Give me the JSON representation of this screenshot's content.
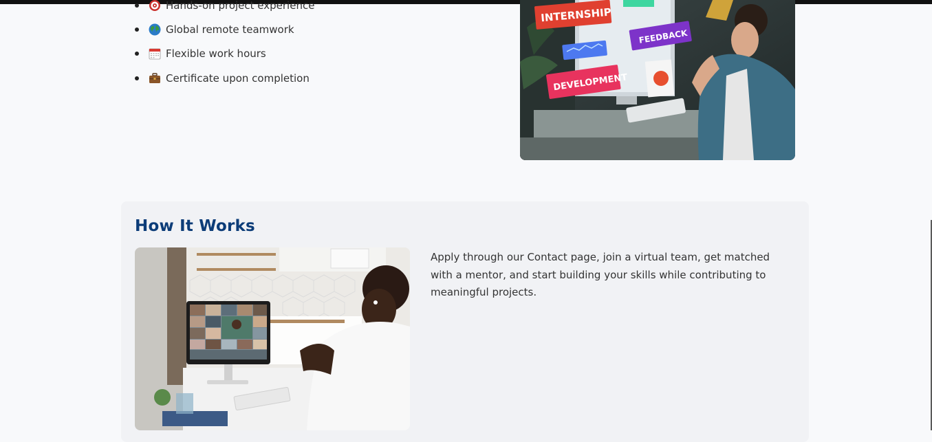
{
  "benefits": [
    {
      "icon": "target-icon",
      "label": "Hands-on project experience"
    },
    {
      "icon": "globe-icon",
      "label": "Global remote teamwork"
    },
    {
      "icon": "calendar-icon",
      "label": "Flexible work hours"
    },
    {
      "icon": "briefcase-icon",
      "label": "Certificate upon completion"
    }
  ],
  "hero_image": {
    "tags": [
      "INTERNSHIP",
      "FEEDBACK",
      "DEVELOPMENT"
    ]
  },
  "how_it_works": {
    "title": "How It Works",
    "description": "Apply through our Contact page, join a virtual team, get matched with a mentor, and start building your skills while contributing to meaningful projects."
  },
  "colors": {
    "heading": "#0c3c78",
    "background": "#f8f9fb",
    "card": "#f1f2f5"
  }
}
